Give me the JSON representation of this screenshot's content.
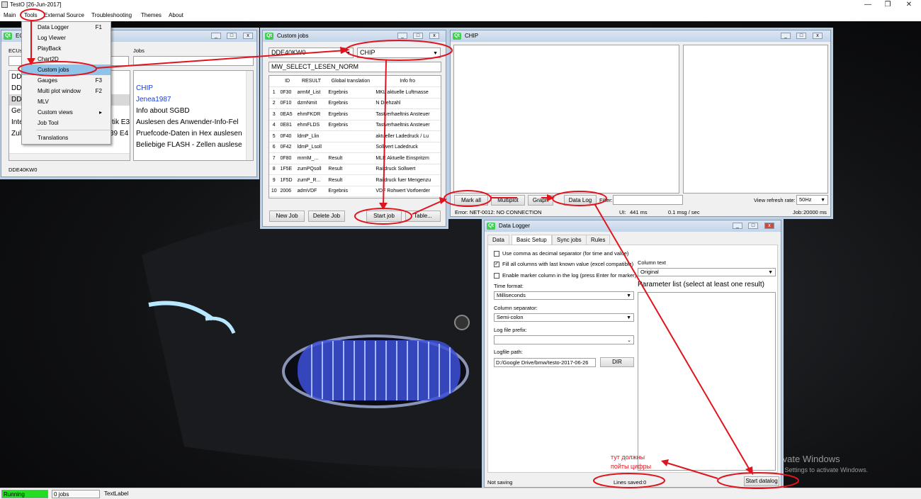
{
  "app": {
    "title": "TestO [26-Jun-2017]"
  },
  "menubar": {
    "items": [
      "Main",
      "Tools",
      "External Source",
      "Troubleshooting",
      "Themes",
      "About"
    ]
  },
  "tools_menu": {
    "items": [
      {
        "label": "Data Logger",
        "shortcut": "F1"
      },
      {
        "label": "Log Viewer",
        "shortcut": ""
      },
      {
        "label": "PlayBack",
        "shortcut": ""
      },
      {
        "label": "Chart2D",
        "shortcut": ""
      },
      {
        "label": "Custom jobs",
        "shortcut": ""
      },
      {
        "label": "Gauges",
        "shortcut": "F3"
      },
      {
        "label": "Multi plot window",
        "shortcut": "F2"
      },
      {
        "label": "MLV",
        "shortcut": ""
      },
      {
        "label": "Custom views",
        "shortcut": "▸"
      },
      {
        "label": "Job Tool",
        "shortcut": ""
      },
      {
        "label": "Translations",
        "shortcut": ""
      }
    ]
  },
  "ecu_window": {
    "title": "ECUs",
    "ecus_label": "ECUs",
    "jobs_label": "Jobs",
    "ecu_items": [
      "DD",
      "DD",
      "DD",
      "Get",
      "Inte",
      "Zul"
    ],
    "ecu_items_right": [
      "",
      "",
      "",
      "",
      "tik E3",
      "39 E4"
    ],
    "job_items": [
      "CHIP",
      "Jenea1987",
      "Info about SGBD",
      "Auslesen des Anwender-Info-Fel",
      "Pruefcode-Daten in Hex auslesen",
      "Beliebige FLASH - Zellen auslese"
    ],
    "status": "DDE40KW0"
  },
  "custom_jobs": {
    "title": "Custom jobs",
    "ecu_combo": "DDE40KW0",
    "job_combo": "CHIP",
    "job_name": "MW_SELECT_LESEN_NORM",
    "columns": [
      "",
      "ID",
      "RESULT",
      "Global translation",
      "Info fro"
    ],
    "rows": [
      [
        "1",
        "0F30",
        "armM_List",
        "Ergebnis",
        "MKL aktuelle Luftmasse"
      ],
      [
        "2",
        "0F10",
        "dzmNmit",
        "Ergebnis",
        "N Drehzahl"
      ],
      [
        "3",
        "0EA5",
        "ehmFKDR",
        "Ergebnis",
        "Tastverhaeltnis Ansteuer"
      ],
      [
        "4",
        "0E81",
        "ehmFLDS",
        "Ergebnis",
        "Tastverhaeltnis Ansteuer"
      ],
      [
        "5",
        "0F40",
        "ldmP_Llin",
        "",
        "aktueller Ladedruck / Lu"
      ],
      [
        "6",
        "0F42",
        "ldmP_Lsoll",
        "",
        "Sollwert Ladedruck"
      ],
      [
        "7",
        "0F80",
        "mrmM_...",
        "Result",
        "MLE Aktuelle Einspritzm"
      ],
      [
        "8",
        "1F5E",
        "zumPQsoll",
        "Result",
        "Raildruck Sollwert"
      ],
      [
        "9",
        "1F5D",
        "zumP_R...",
        "Result",
        "Raildruck fuer Mengenzu"
      ],
      [
        "10",
        "2006",
        "admVDF",
        "Ergebnis",
        "VDF Rohwert Vorfoerder"
      ]
    ],
    "buttons": {
      "new_job": "New Job",
      "delete_job": "Delete Job",
      "start_job": "Start job",
      "table": "Table..."
    }
  },
  "chip_window": {
    "title": "CHIP",
    "buttons": {
      "mark_all": "Mark all",
      "multiplot": "Multiplot",
      "graph": "Graph",
      "data_log": "Data Log"
    },
    "filter_label": "Filter:",
    "refresh_label": "View refresh rate:",
    "refresh_value": "50Hz",
    "status": {
      "error": "Error: NET-0012: NO CONNECTION",
      "ui": "UI:",
      "ui_value": "441 ms",
      "rate": "0.1 msg / sec",
      "job": "Job:",
      "job_value": "20000 ms"
    }
  },
  "data_logger": {
    "title": "Data Logger",
    "tabs": [
      "Data",
      "Basic Setup",
      "Sync jobs",
      "Rules"
    ],
    "checks": [
      {
        "label": "Use comma as decimal separator (for time and value)",
        "checked": false
      },
      {
        "label": "Fill all columns with last known value (excel compatible)",
        "checked": true
      },
      {
        "label": "Enable marker column in the log (press Enter for marker)",
        "checked": false
      }
    ],
    "time_format_label": "Time format:",
    "time_format_value": "Milliseconds",
    "column_sep_label": "Column separator:",
    "column_sep_value": "Semi-colon",
    "prefix_label": "Log file prefix:",
    "prefix_value": "",
    "path_label": "Logfile path:",
    "path_value": "D:/Google Drive/bmw/testo-2017-06-26",
    "dir_button": "DIR",
    "column_text_label": "Column text",
    "column_text_value": "Original",
    "param_list_label": "Parameter list  (select at least one result)",
    "status_left": "Not saving",
    "lines_saved": "Lines saved:0",
    "start_button": "Start datalog"
  },
  "annotation": {
    "text_line1": "тут должны",
    "text_line2": "пойты цифры"
  },
  "watermark": {
    "line1": "Activate Windows",
    "line2": "Go to Settings to activate Windows."
  },
  "statusbar": {
    "running": "Running",
    "jobs": "0 jobs",
    "label": "TextLabel"
  },
  "colors": {
    "annotation_red": "#e0141e",
    "running_green": "#22dd22",
    "qt_green": "#41cd52",
    "menu_highlight": "#8fc3ea",
    "link_blue": "#1a3fd8"
  }
}
